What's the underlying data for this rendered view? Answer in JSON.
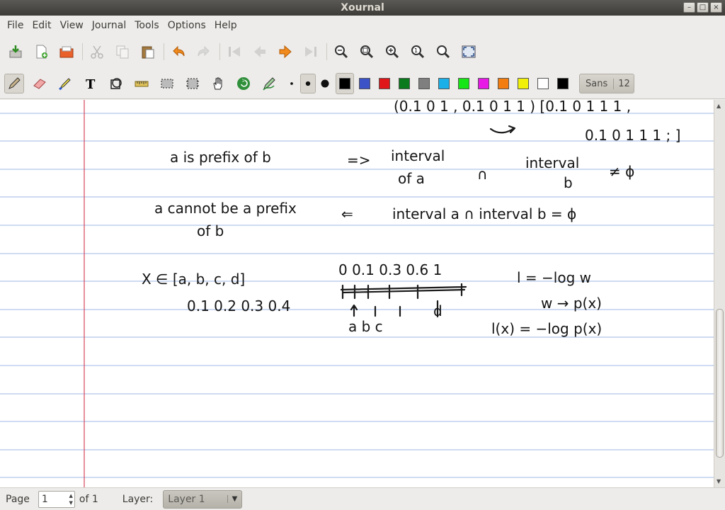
{
  "window": {
    "title": "Xournal"
  },
  "menu": [
    "File",
    "Edit",
    "View",
    "Journal",
    "Tools",
    "Options",
    "Help"
  ],
  "toolbar_main": {
    "icons": [
      "save-icon",
      "new-page-icon",
      "open-icon",
      "cut-icon",
      "copy-icon",
      "paste-icon",
      "undo-icon",
      "redo-icon",
      "first-page-icon",
      "previous-page-icon",
      "next-page-icon",
      "last-page-icon",
      "zoom-out-icon",
      "zoom-page-width-icon",
      "zoom-in-icon",
      "zoom-normal-icon",
      "zoom-set-icon",
      "fullscreen-icon"
    ]
  },
  "toolbar_tools": {
    "icons": [
      "pen-icon",
      "eraser-icon",
      "highlighter-icon",
      "text-tool-icon",
      "shape-recognizer-icon",
      "ruler-icon",
      "select-rectangle-icon",
      "select-region-icon",
      "hand-tool-icon",
      "default-tool-icon",
      "default-pen-icon"
    ],
    "thickness": [
      "fine",
      "medium",
      "thick"
    ],
    "colors": [
      "#000000",
      "#3c53c8",
      "#e0171a",
      "#0a7a1c",
      "#7f7f7f",
      "#1cb0e8",
      "#16e616",
      "#e619e6",
      "#f47d10",
      "#f0f00a",
      "#ffffff"
    ],
    "font_name": "Sans",
    "font_size": "12"
  },
  "notes": {
    "line1_top": "(0.1 0 1 , 0.1 0 1 1 )  [0.1 0 1 1 1 ,",
    "line1_bottom": "0.1 0 1 1 1 ; ]",
    "row1_left": "a is prefix of b",
    "row1_arrow": "=>",
    "row1_mid_top": "interval",
    "row1_mid_bottom": "of a",
    "row1_cap": "∩",
    "row1_right_top": "interval",
    "row1_right_bottom": "b",
    "row1_neq": "≠ ϕ",
    "row2_left_top": "a cannot be a prefix",
    "row2_left_bottom": "of b",
    "row2_arrow": "⇐",
    "row2_right": "interval a ∩ interval b = ϕ",
    "row3_set": "X ∈ [a, b, c, d]",
    "row3_probs": "0.1  0.2  0.3  0.4",
    "row3_ticks": "0   0.1   0.3   0.6       1",
    "row3_labels": "a    b    c",
    "row3_d": "d",
    "row3_eq1": "l  =  −log w",
    "row3_eq2": "w → p(x)",
    "row3_eq3": "l(x)  =  −log p(x)"
  },
  "statusbar": {
    "page_label": "Page",
    "page_value": "1",
    "of_label": "of 1",
    "layer_label": "Layer:",
    "layer_value": "Layer 1"
  }
}
